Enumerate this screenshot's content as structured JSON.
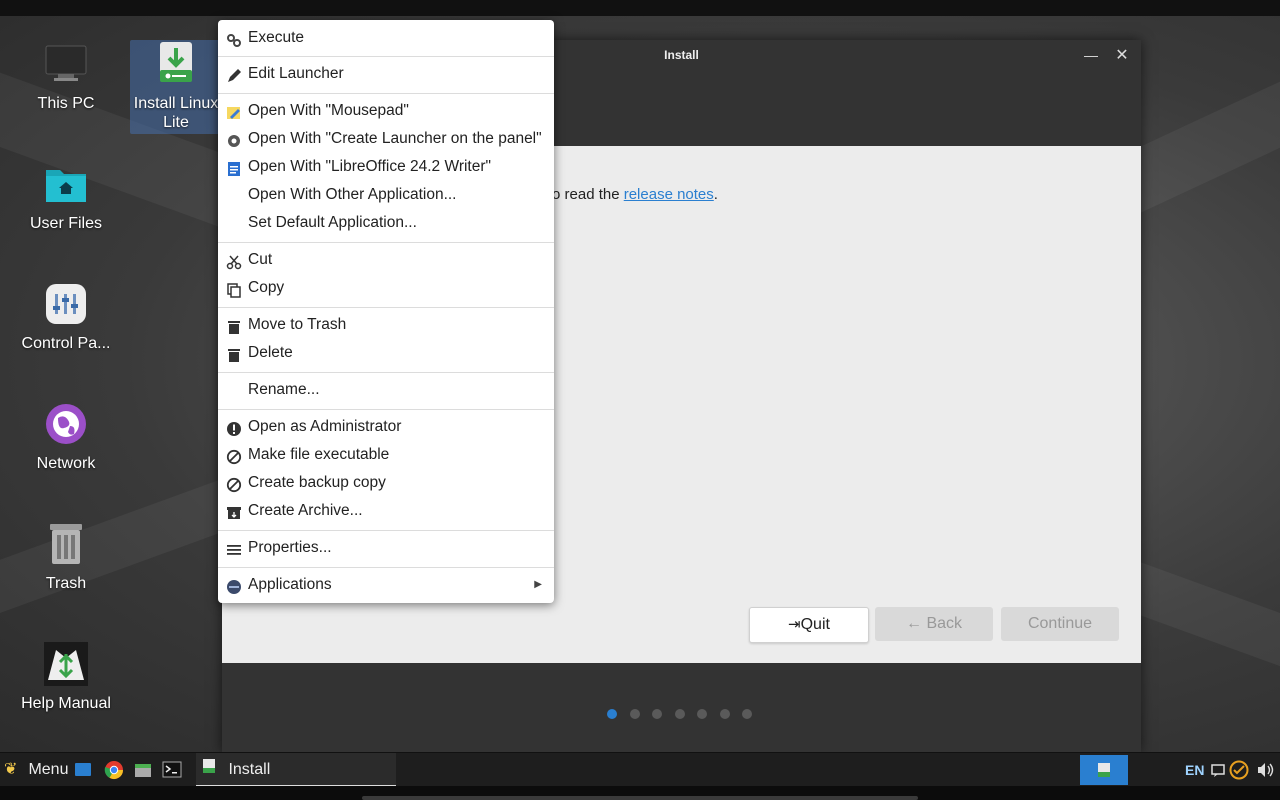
{
  "desktop": {
    "icons": [
      {
        "label": "This PC",
        "icon": "monitor-icon"
      },
      {
        "label": "Install Linux\nLite",
        "icon": "installer-download-icon"
      },
      {
        "label": "User Files",
        "icon": "home-folder-icon"
      },
      {
        "label": "Control Pa...",
        "icon": "control-panel-icon"
      },
      {
        "label": "Network",
        "icon": "network-globe-icon"
      },
      {
        "label": "Trash",
        "icon": "trash-can-icon"
      },
      {
        "label": "Help Manual",
        "icon": "help-manual-icon"
      }
    ]
  },
  "installer": {
    "title": "Install",
    "text_prefix": "o read the ",
    "link_text": "release notes",
    "text_suffix": ".",
    "buttons": {
      "quit": "Quit",
      "back": "Back",
      "continue": "Continue"
    },
    "step_count": 7,
    "active_step": 0
  },
  "context_menu": {
    "items": {
      "execute": "Execute",
      "edit_launcher": "Edit Launcher",
      "open_mousepad": "Open With \"Mousepad\"",
      "open_create_launcher": "Open With \"Create Launcher on the panel\"",
      "open_libreoffice": "Open With \"LibreOffice 24.2 Writer\"",
      "open_other": "Open With Other Application...",
      "set_default": "Set Default Application...",
      "cut": "Cut",
      "copy": "Copy",
      "move_to_trash": "Move to Trash",
      "delete": "Delete",
      "rename": "Rename...",
      "open_admin": "Open as Administrator",
      "make_executable": "Make file executable",
      "backup_copy": "Create backup copy",
      "create_archive": "Create Archive...",
      "properties": "Properties...",
      "applications": "Applications"
    }
  },
  "taskbar": {
    "menu_label": "Menu",
    "task_label": "Install",
    "language": "EN"
  },
  "colors": {
    "accent": "#2a7fd0",
    "menu_bg": "#ffffff",
    "taskbar_bg": "#1e1e1e"
  }
}
